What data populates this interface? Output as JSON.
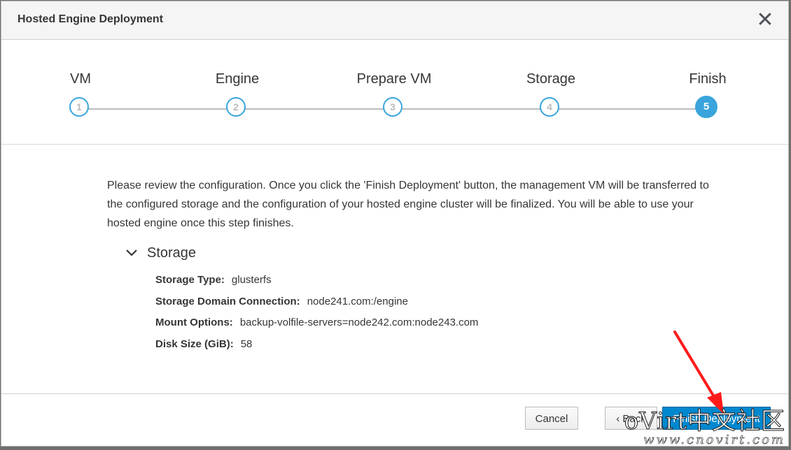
{
  "dialog": {
    "title": "Hosted Engine Deployment"
  },
  "wizard": {
    "steps": [
      {
        "label": "VM",
        "number": "1"
      },
      {
        "label": "Engine",
        "number": "2"
      },
      {
        "label": "Prepare VM",
        "number": "3"
      },
      {
        "label": "Storage",
        "number": "4"
      },
      {
        "label": "Finish",
        "number": "5"
      }
    ],
    "active_step": 5
  },
  "content": {
    "intro": "Please review the configuration. Once you click the 'Finish Deployment' button, the management VM will be transferred to the configured storage and the configuration of your hosted engine cluster will be finalized. You will be able to use your hosted engine once this step finishes.",
    "section_title": "Storage",
    "details": [
      {
        "label": "Storage Type:",
        "value": "glusterfs"
      },
      {
        "label": "Storage Domain Connection:",
        "value": "node241.com:/engine"
      },
      {
        "label": "Mount Options:",
        "value": "backup-volfile-servers=node242.com:node243.com"
      },
      {
        "label": "Disk Size (GiB):",
        "value": "58"
      }
    ]
  },
  "footer": {
    "cancel_label": "Cancel",
    "back_label": "‹ Back",
    "finish_label": "Finish Deployment"
  },
  "watermark": {
    "top": "oVirt中文社区",
    "bottom": "www.cnovirt.com"
  },
  "colors": {
    "accent": "#39a5dc",
    "primary_button": "#0088ce",
    "annotation_arrow": "#ff1a1a"
  }
}
